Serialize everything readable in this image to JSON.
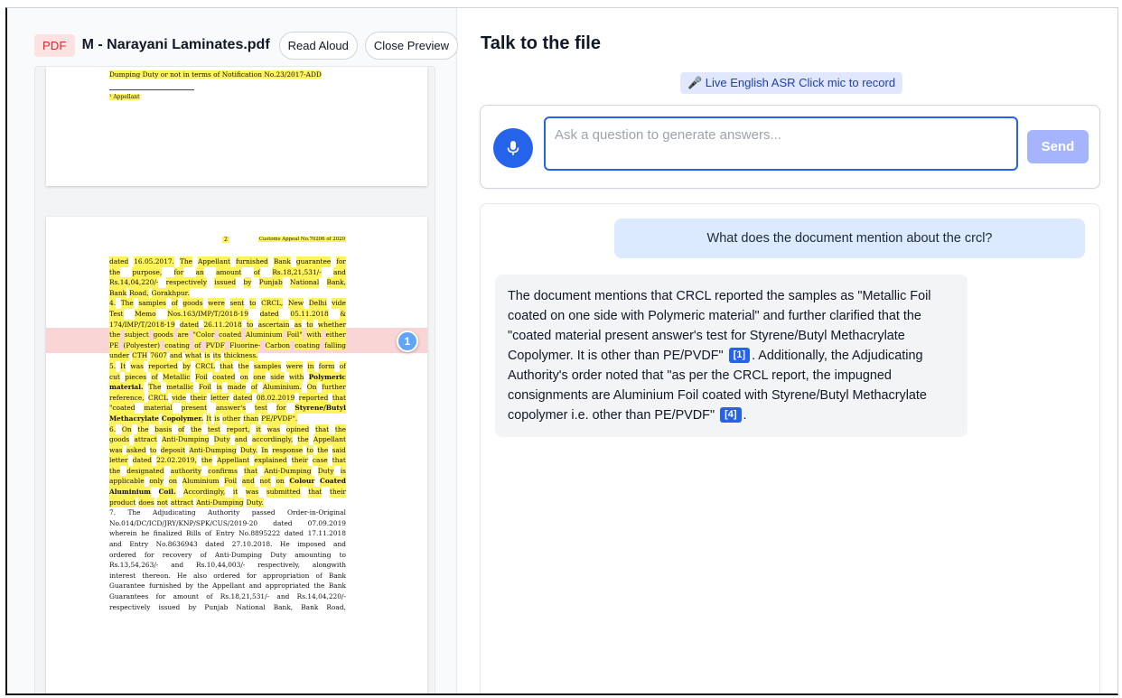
{
  "file": {
    "badge": "PDF",
    "name": "M - Narayani Laminates.pdf",
    "read_aloud": "Read Aloud",
    "close_preview": "Close Preview"
  },
  "pdf": {
    "page1": {
      "line": "Dumping Duty or not in terms of Notification No.23/2017-ADD",
      "footnote": "¹ Appellant"
    },
    "page2": {
      "page_number": "2",
      "appeal_no": "Customs Appeal No.70206 of 2020",
      "citation_marker": "1",
      "lines": [
        {
          "w": [
            "dated",
            "16.05.2017.",
            "The",
            "Appellant",
            "furnished",
            "Bank",
            "guarantee",
            "for"
          ]
        },
        {
          "w": [
            "the",
            "purpose,",
            "for",
            "an",
            "amount",
            "of",
            "Rs.18,21,531/-",
            "and"
          ]
        },
        {
          "w": [
            "Rs.14,04,220/-",
            "respectively",
            "issued",
            "by",
            "Punjab",
            "National",
            "Bank,"
          ]
        },
        {
          "w": [
            "Bank",
            "Road,",
            "Gorakhpur."
          ],
          "last": true
        },
        {
          "w": [
            "4.",
            "The",
            "samples",
            "of",
            "goods",
            "were",
            "sent",
            "to",
            "CRCL,",
            "New",
            "Delhi",
            "vide"
          ]
        },
        {
          "w": [
            "Test",
            "Memo",
            "Nos.163/IMP/T/2018-19",
            "dated",
            "05.11.2018",
            "&"
          ]
        },
        {
          "w": [
            "174/IMP/T/2018-19",
            "dated",
            "26.11.2018",
            "to",
            "ascertain",
            "as",
            "to",
            "whether"
          ]
        },
        {
          "w": [
            "the",
            "subject",
            "goods",
            "are",
            "\"Color",
            "coated",
            "Aluminium",
            "Foil\"",
            "with",
            "either"
          ]
        },
        {
          "w": [
            "PE",
            "(Polyester)",
            "coating",
            "of",
            "PVDF",
            "Fluorine-",
            "Carbon",
            "coating",
            "falling"
          ]
        },
        {
          "w": [
            "under",
            "CTH",
            "7607",
            "and",
            "what",
            "is",
            "its",
            "thickness."
          ],
          "last": true
        },
        {
          "w": [
            "5.",
            "It",
            "was",
            "reported",
            "by",
            "CRCL",
            "that",
            "the",
            "samples",
            "were",
            "in",
            "form",
            "of"
          ]
        },
        {
          "w": [
            "cut",
            "pieces",
            "of",
            "Metallic",
            "Foil",
            "coated",
            "on",
            "one",
            "side",
            "with",
            "Polymeric"
          ]
        },
        {
          "w": [
            "material.",
            "The",
            "metallic",
            "Foil",
            "is",
            "made",
            "of",
            "Aluminium.",
            "On",
            "further"
          ]
        },
        {
          "w": [
            "reference,",
            "CRCL",
            "vide",
            "their",
            "letter",
            "dated",
            "08.02.2019",
            "reported",
            "that"
          ]
        },
        {
          "w": [
            "\"coated",
            "material",
            "present",
            "answer's",
            "test",
            "for",
            "Styrene/Butyl"
          ]
        },
        {
          "w": [
            "Methacrylate",
            "Copolymer.",
            "It",
            "is",
            "other",
            "than",
            "PE/PVDF\"."
          ],
          "last": true
        },
        {
          "w": [
            "6.",
            "On",
            "the",
            "basis",
            "of",
            "the",
            "test",
            "report,",
            "it",
            "was",
            "opined",
            "that",
            "the"
          ]
        },
        {
          "w": [
            "goods",
            "attract",
            "Anti-Dumping",
            "Duty",
            "and",
            "accordingly,",
            "the",
            "Appellant"
          ]
        },
        {
          "w": [
            "was",
            "asked",
            "to",
            "deposit",
            "Anti-Dumping",
            "Duty.",
            "In",
            "response",
            "to",
            "the",
            "said"
          ]
        },
        {
          "w": [
            "letter",
            "dated",
            "22.02.2019,",
            "the",
            "Appellant",
            "explained",
            "their",
            "case",
            "that"
          ]
        },
        {
          "w": [
            "the",
            "designated",
            "authority",
            "confirms",
            "that",
            "Anti-Dumping",
            "Duty",
            "is"
          ]
        },
        {
          "w": [
            "applicable",
            "only",
            "on",
            "Aluminium",
            "Foil",
            "and",
            "not",
            "on",
            "Colour",
            "Coated"
          ]
        },
        {
          "w": [
            "Aluminium",
            "Coil.",
            "Accordingly,",
            "it",
            "was",
            "submitted",
            "that",
            "their"
          ]
        },
        {
          "w": [
            "product",
            "does",
            "not",
            "attract",
            "Anti-Dumping",
            "Duty."
          ],
          "last": true
        },
        {
          "w": [
            "7.",
            "The",
            "Adjudicating",
            "Authority",
            "passed",
            "Order-in-Original"
          ]
        },
        {
          "w": [
            "No.014/DC/ICD/JRY/KNP/SPK/CUS/2019-20",
            "dated",
            "07.09.2019"
          ]
        },
        {
          "w": [
            "wherein",
            "he",
            "finalized",
            "Bills",
            "of",
            "Entry",
            "No.8895222",
            "dated",
            "17.11.2018"
          ]
        },
        {
          "w": [
            "and",
            "Entry",
            "No.8636943",
            "dated",
            "27.10.2018.",
            "He",
            "imposed",
            "and"
          ]
        },
        {
          "w": [
            "ordered",
            "for",
            "recovery",
            "of",
            "Anti-Dumping",
            "Duty",
            "amounting",
            "to"
          ]
        },
        {
          "w": [
            "Rs.13,54,263/-",
            "and",
            "Rs.10,44,003/-",
            "respectively,",
            "alongwith"
          ]
        },
        {
          "w": [
            "interest",
            "thereon.",
            "He",
            "also",
            "ordered",
            "for",
            "appropriation",
            "of",
            "Bank"
          ]
        },
        {
          "w": [
            "Guarantee",
            "furnished",
            "by",
            "the",
            "Appellant",
            "and",
            "appropriated",
            "the",
            "Bank"
          ]
        },
        {
          "w": [
            "Guarantees",
            "for",
            "amount",
            "of",
            "Rs.18,21,531/-",
            "and",
            "Rs.14,04,220/-"
          ]
        },
        {
          "w": [
            "respectively",
            "issued",
            "by",
            "Punjab",
            "National",
            "Bank,",
            "Bank",
            "Road,"
          ]
        }
      ]
    }
  },
  "talk": {
    "title": "Talk to the file",
    "asr_label": "🎤 Live English ASR",
    "asr_hint": "Click mic to record",
    "placeholder": "Ask a question to generate answers...",
    "send": "Send"
  },
  "chat": {
    "user_question": "What does the document mention about the crcl?",
    "answer_part1": "The document mentions that CRCL reported the samples as \"Metallic Foil coated on one side with Polymeric material\" and further clarified that the \"coated material present answer's test for Styrene/Butyl Methacrylate Copolymer. It is other than PE/PVDF\"",
    "cite1": "[1]",
    "answer_part2": ". Additionally, the Adjudicating Authority's order noted that \"as per the CRCL report, the impugned consignments are Aluminium Foil coated with Styrene/Butyl Methacrylate copolymer i.e. other than PE/PVDF\"",
    "cite2": "[4]",
    "answer_part3": "."
  },
  "colors": {
    "accent": "#2563eb",
    "highlight": "#fff35c",
    "citation_band": "#ef8686",
    "send_disabled": "#a5b4fc"
  }
}
